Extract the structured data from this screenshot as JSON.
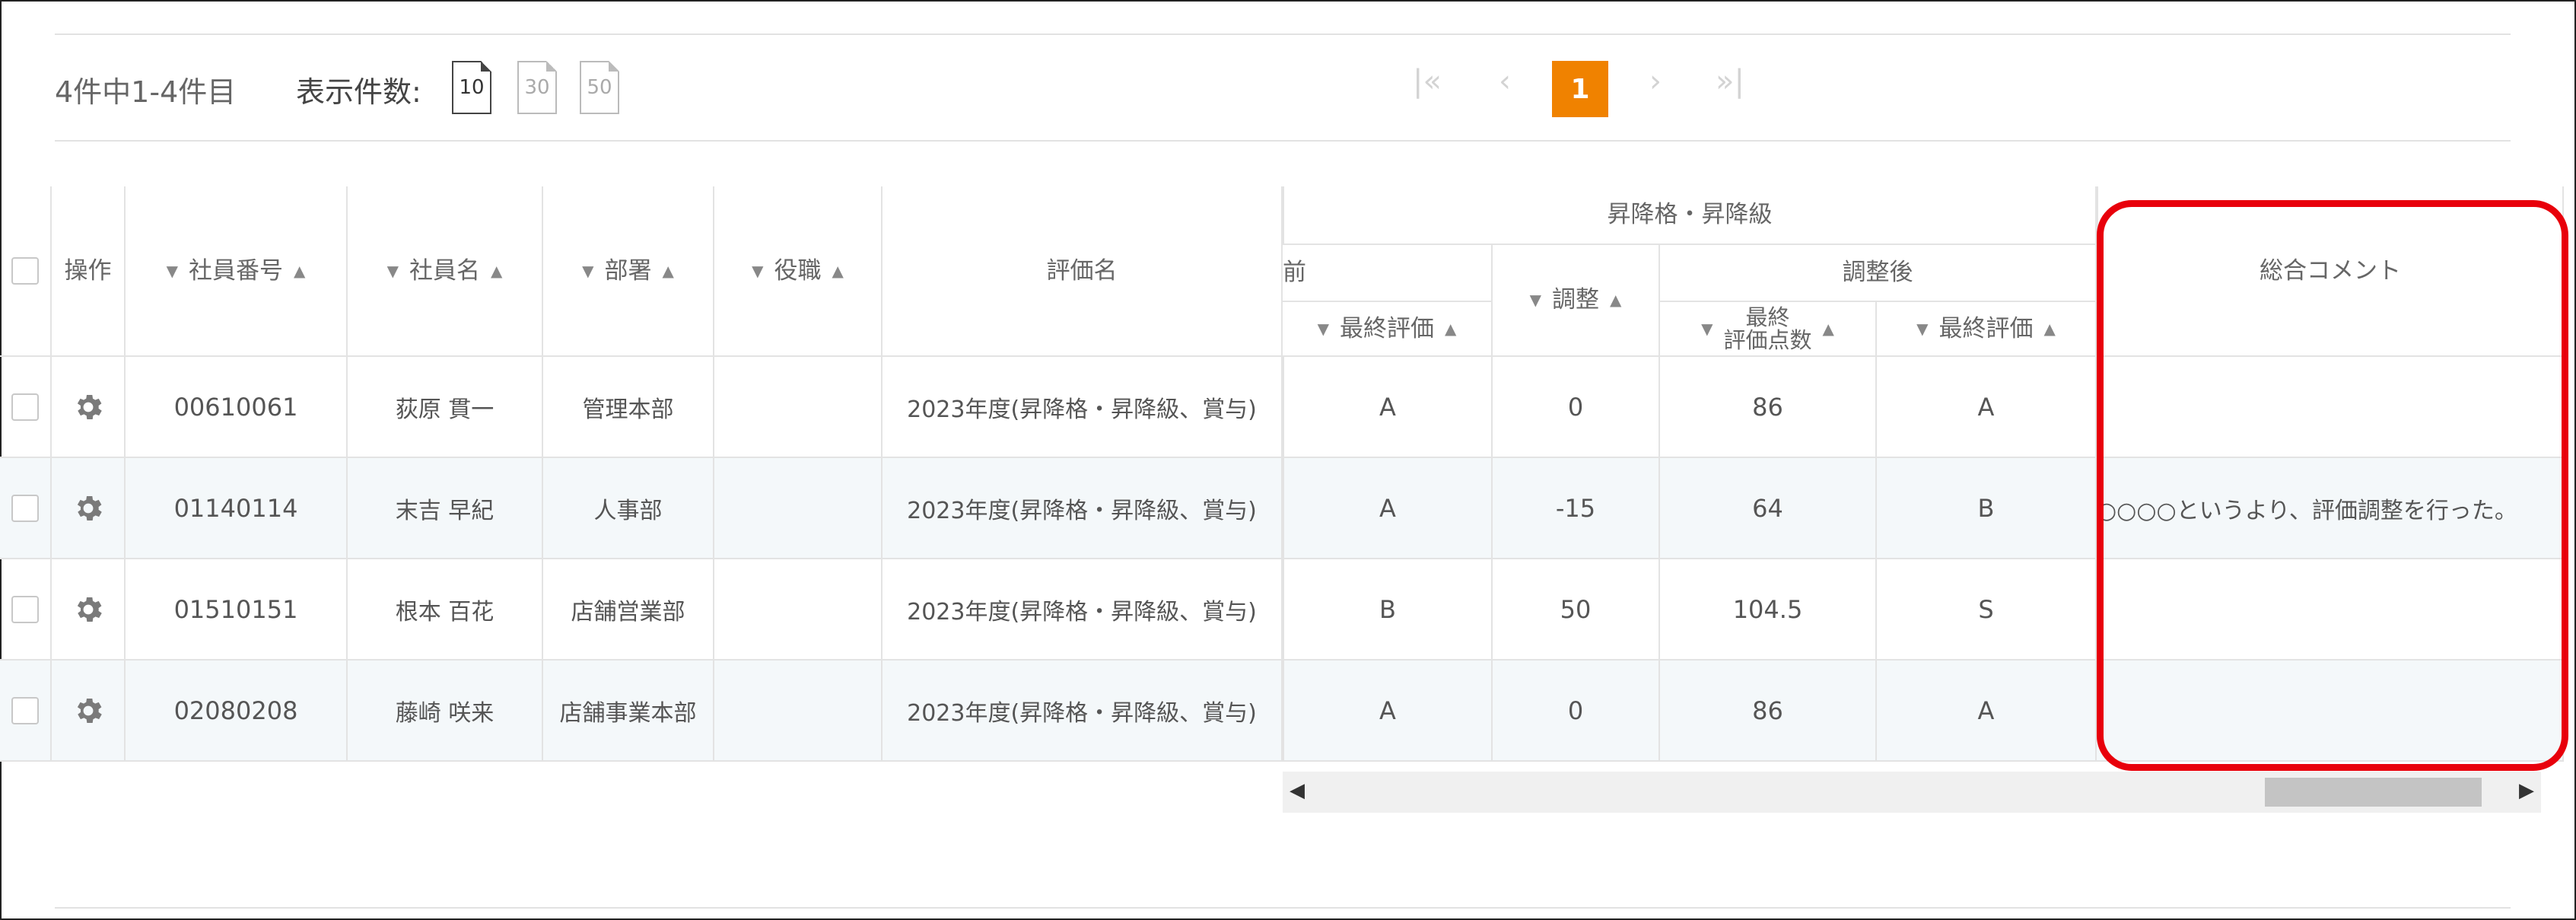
{
  "pager": {
    "count_text": "4件中1-4件目",
    "per_page_label": "表示件数:",
    "per_page_options": [
      "10",
      "30",
      "50"
    ],
    "selected_per_page": "10",
    "first_icon": "first-page-icon",
    "prev_icon": "prev-page-icon",
    "next_icon": "next-page-icon",
    "last_icon": "last-page-icon",
    "current_page": "1",
    "accent_color": "#f08200"
  },
  "table": {
    "headers": {
      "ops": "操作",
      "emp_no": "社員番号",
      "emp_name": "社員名",
      "dept": "部署",
      "title": "役職",
      "eval_name": "評価名",
      "promotion_group": "昇降格・昇降級",
      "before_group": "前",
      "before_final": "最終評価",
      "adjust": "調整",
      "after_group": "調整後",
      "after_points_line1": "最終",
      "after_points_line2": "評価点数",
      "after_final": "最終評価",
      "comment": "総合コメント"
    },
    "rows": [
      {
        "emp_no": "00610061",
        "name": "荻原 貫一",
        "dept": "管理本部",
        "title": "",
        "eval": "2023年度(昇降格・昇降級、賞与)",
        "before_final": "A",
        "adjust": "0",
        "points": "86",
        "after_final": "A",
        "comment": ""
      },
      {
        "emp_no": "01140114",
        "name": "末吉 早紀",
        "dept": "人事部",
        "title": "",
        "eval": "2023年度(昇降格・昇降級、賞与)",
        "before_final": "A",
        "adjust": "-15",
        "points": "64",
        "after_final": "B",
        "comment": "○○○○というより、評価調整を行った。"
      },
      {
        "emp_no": "01510151",
        "name": "根本 百花",
        "dept": "店舗営業部",
        "title": "",
        "eval": "2023年度(昇降格・昇降級、賞与)",
        "before_final": "B",
        "adjust": "50",
        "points": "104.5",
        "after_final": "S",
        "comment": ""
      },
      {
        "emp_no": "02080208",
        "name": "藤崎 咲来",
        "dept": "店舗事業本部",
        "title": "",
        "eval": "2023年度(昇降格・昇降級、賞与)",
        "before_final": "A",
        "adjust": "0",
        "points": "86",
        "after_final": "A",
        "comment": ""
      }
    ]
  },
  "icons": {
    "gear": "gear-icon",
    "sort_asc": "sort-asc-icon",
    "sort_desc": "sort-desc-icon",
    "scroll_left": "scroll-left-icon",
    "scroll_right": "scroll-right-icon"
  },
  "highlight_color": "#e8000b"
}
